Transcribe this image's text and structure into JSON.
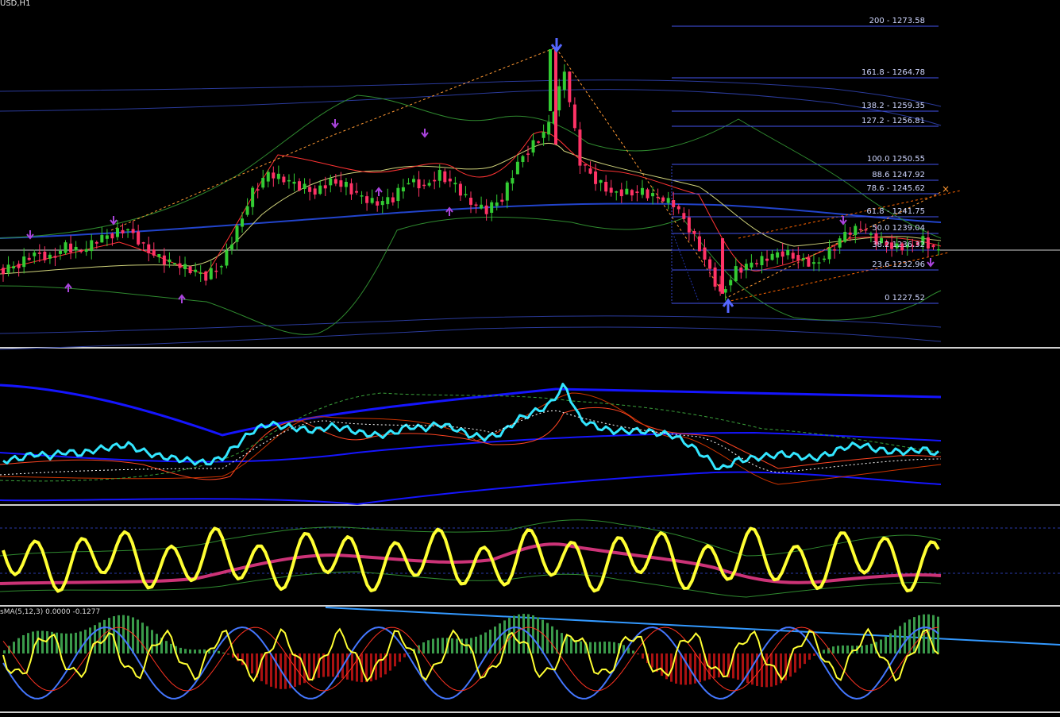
{
  "window": {
    "symbol_timeframe": "USD,H1"
  },
  "colors": {
    "bg": "#000000",
    "bull": "#33cc33",
    "bear": "#ff3366",
    "fib": "#5566ff",
    "fib_text": "#8899ff",
    "bands": "#2a3a9a",
    "green_line": "#2f8a2f",
    "cyan": "#33e6ff",
    "yellow": "#ffff33",
    "pink": "#cc3377",
    "blue_line": "#1515ff",
    "arrow_purple": "#aa44dd",
    "arrow_blue": "#5566ff"
  },
  "fibonacci_levels": [
    {
      "label": "200 - 1273.58"
    },
    {
      "label": "161.8 - 1264.78"
    },
    {
      "label": "138.2 - 1259.35"
    },
    {
      "label": "127.2 - 1256.81"
    },
    {
      "label": "100.0 1250.55"
    },
    {
      "label": "88.6 1247.92"
    },
    {
      "label": "78.6 - 1245.62"
    },
    {
      "label": "61.8 - 1241.75"
    },
    {
      "label": "50.0 1239.04"
    },
    {
      "label": "38.2 1236.32"
    },
    {
      "label": "23.6 1232.96"
    },
    {
      "label": "0 1227.52"
    }
  ],
  "indicator_label": "sMA(5,12,3) 0.0000 -0.1277",
  "chart_data": {
    "type": "line",
    "title": "",
    "series": [
      {
        "values": [
          1233,
          1234,
          1236,
          1235,
          1237,
          1236,
          1238,
          1239,
          1240,
          1237,
          1235,
          1234,
          1233,
          1232,
          1234,
          1240,
          1246,
          1249,
          1248,
          1247,
          1246,
          1248,
          1247,
          1245,
          1244,
          1245,
          1248,
          1247,
          1249,
          1247,
          1244,
          1243,
          1245,
          1251,
          1254,
          1257,
          1266,
          1251,
          1248,
          1246,
          1246,
          1246,
          1245,
          1244,
          1240,
          1235,
          1229,
          1233,
          1234,
          1235,
          1236,
          1235,
          1234,
          1236,
          1239,
          1240,
          1238,
          1237,
          1237,
          1238,
          1236
        ]
      }
    ]
  }
}
